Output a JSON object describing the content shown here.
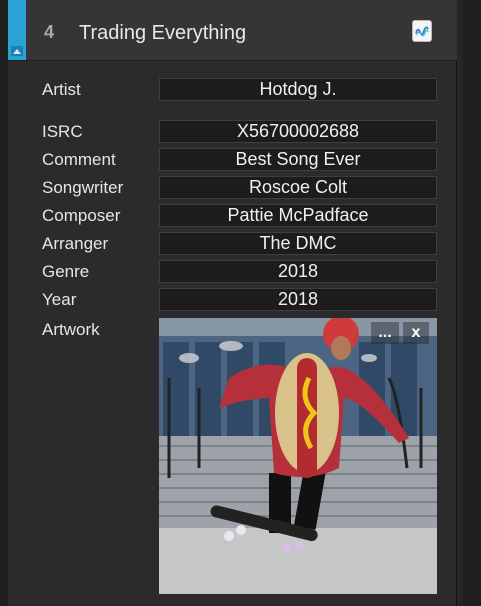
{
  "header": {
    "track_number": "4",
    "track_title": "Trading Everything",
    "icon": "waveform-app-icon"
  },
  "fields": [
    {
      "label": "Artist",
      "value": "Hotdog J."
    },
    {
      "label": "ISRC",
      "value": "X56700002688"
    },
    {
      "label": "Comment",
      "value": "Best Song Ever"
    },
    {
      "label": "Songwriter",
      "value": "Roscoe Colt"
    },
    {
      "label": "Composer",
      "value": "Pattie McPadface"
    },
    {
      "label": "Arranger",
      "value": "The DMC"
    },
    {
      "label": "Genre",
      "value": "2018"
    },
    {
      "label": "Year",
      "value": "2018"
    }
  ],
  "artwork": {
    "label": "Artwork",
    "more_button": "...",
    "close_button": "x"
  },
  "colors": {
    "accent": "#29a3d6",
    "panel": "#2b2b2b",
    "field_bg": "#1c1c1c"
  }
}
